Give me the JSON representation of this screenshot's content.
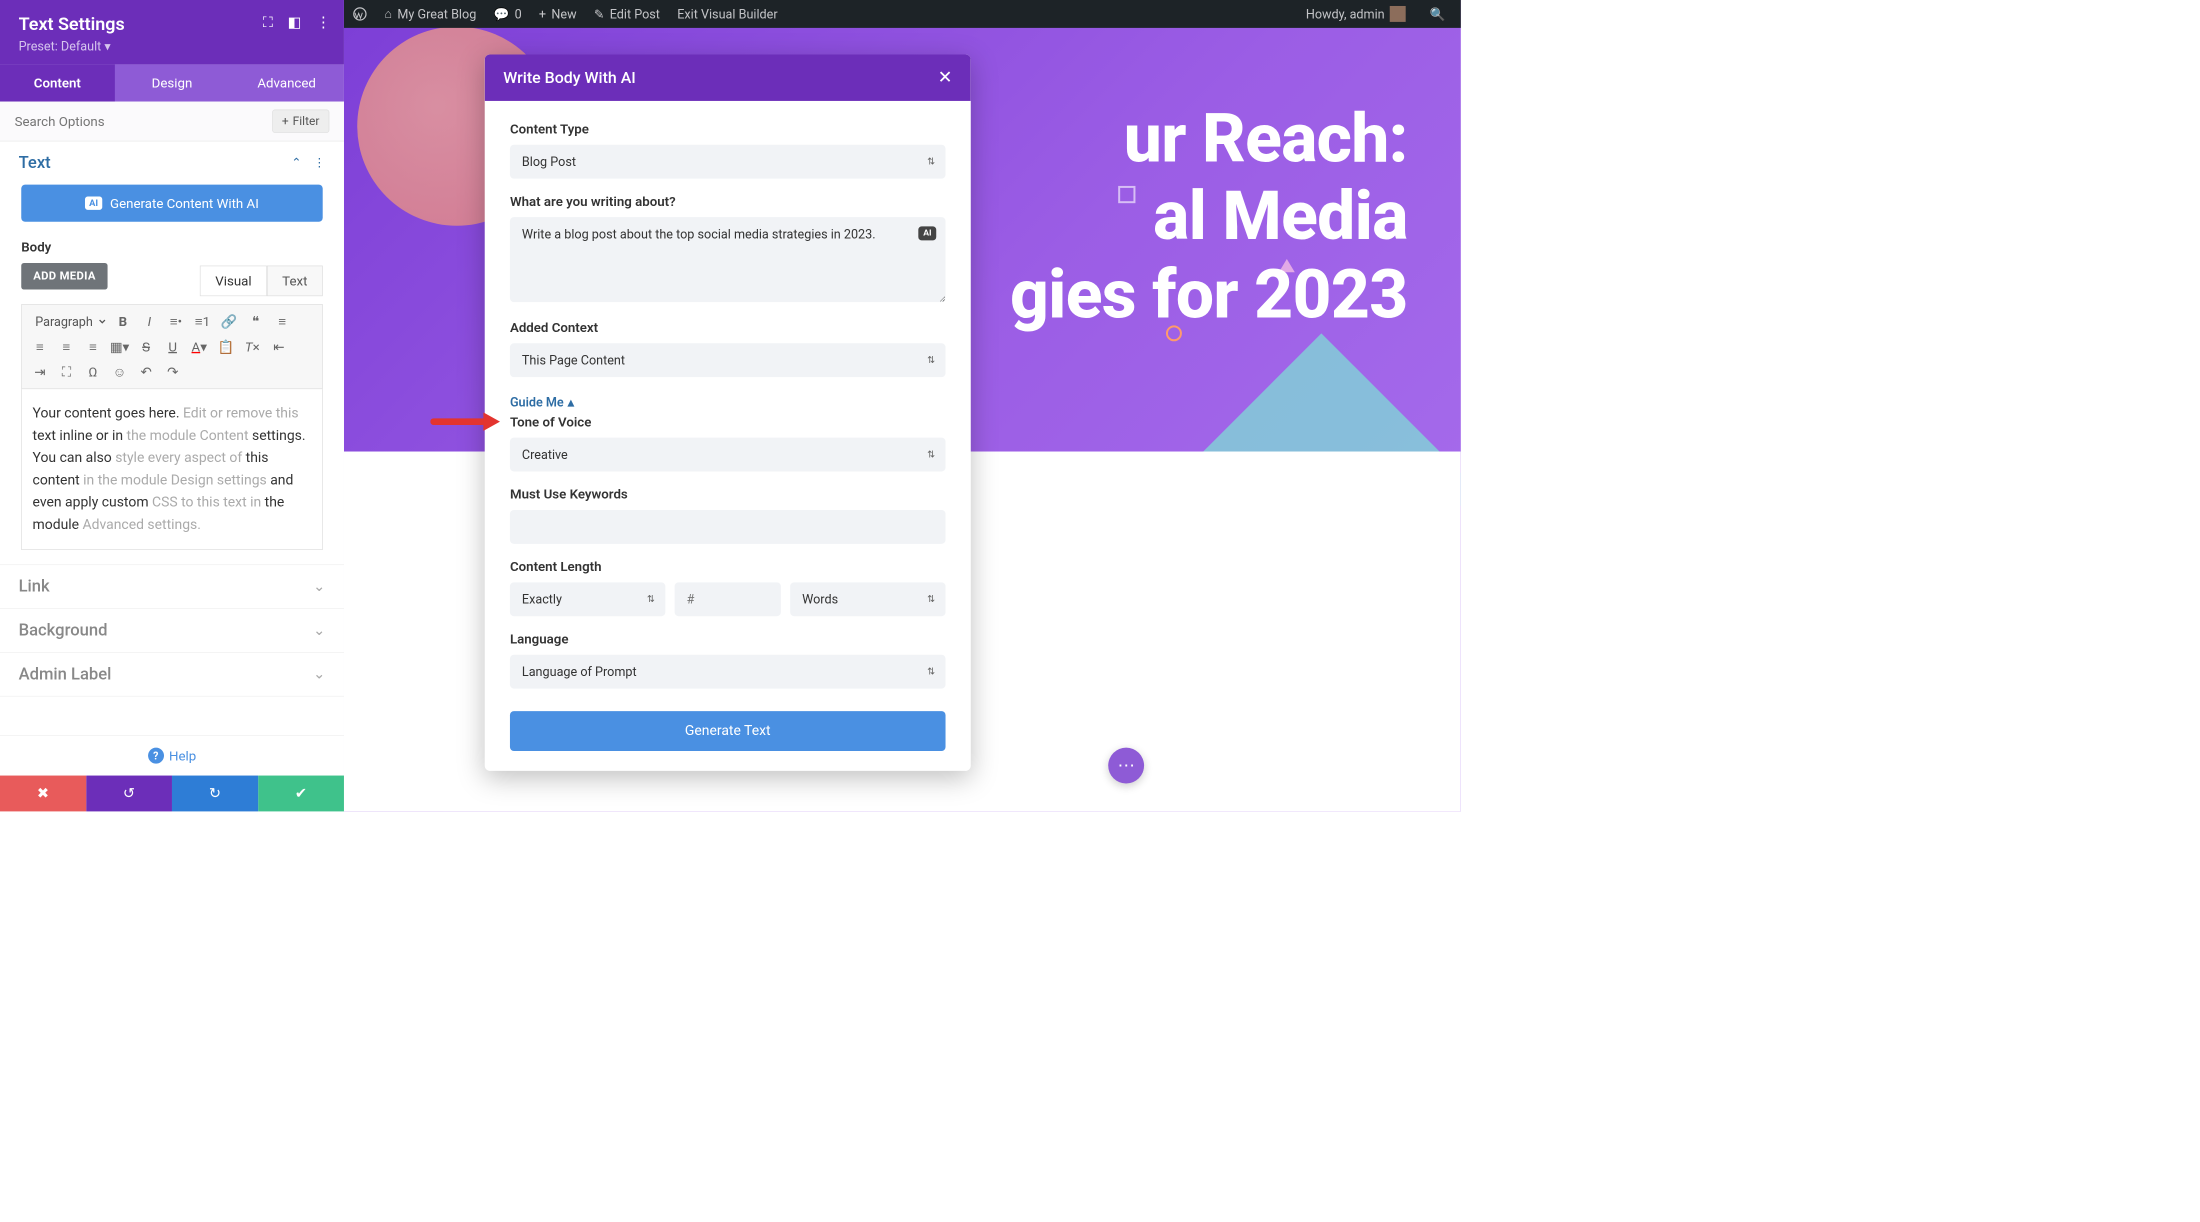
{
  "wpbar": {
    "site": "My Great Blog",
    "comments": "0",
    "new": "New",
    "edit": "Edit Post",
    "exit": "Exit Visual Builder",
    "howdy": "Howdy, admin"
  },
  "settings": {
    "title": "Text Settings",
    "preset": "Preset: Default ▾",
    "tabs": {
      "content": "Content",
      "design": "Design",
      "advanced": "Advanced"
    },
    "search_placeholder": "Search Options",
    "filter": "Filter",
    "sections": {
      "text": "Text",
      "link": "Link",
      "background": "Background",
      "admin": "Admin Label"
    },
    "gen_ai": "Generate Content With AI",
    "ai_badge": "AI",
    "body_label": "Body",
    "add_media": "ADD MEDIA",
    "editor_tabs": {
      "visual": "Visual",
      "text": "Text"
    },
    "paragraph": "Paragraph",
    "editor_content": {
      "t1": "Your content goes here. ",
      "g1": "Edit or remove this",
      "t2": " text inline or in ",
      "g2": "the module Content",
      "t3": " settings. You can also ",
      "g3": "style every aspect of",
      "t4": " this content ",
      "g4": "in the module Design settings",
      "t5": " and even apply custom ",
      "g5": "CSS to this text in",
      "t6": " the module ",
      "g6": "Advanced settings."
    },
    "help": "Help"
  },
  "hero": {
    "line1": "ur Reach:",
    "line2": "al Media",
    "line3": "gies for 2023"
  },
  "modal": {
    "title": "Write Body With AI",
    "content_type_label": "Content Type",
    "content_type": "Blog Post",
    "about_label": "What are you writing about?",
    "about_value": "Write a blog post about the top social media strategies in 2023.",
    "ai_chip": "AI",
    "context_label": "Added Context",
    "context": "This Page Content",
    "guide": "Guide Me",
    "tone_label": "Tone of Voice",
    "tone": "Creative",
    "keywords_label": "Must Use Keywords",
    "keywords_value": "",
    "length_label": "Content Length",
    "length_mode": "Exactly",
    "length_num_placeholder": "#",
    "length_unit": "Words",
    "lang_label": "Language",
    "lang": "Language of Prompt",
    "generate": "Generate Text"
  }
}
